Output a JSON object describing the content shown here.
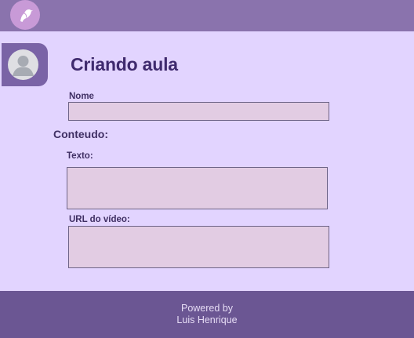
{
  "header": {
    "logo_icon": "bird-icon"
  },
  "profile": {
    "avatar_icon": "user-avatar-icon"
  },
  "form": {
    "title": "Criando aula",
    "name_label": "Nome",
    "name_value": "",
    "content_section_label": "Conteudo:",
    "text_label": "Texto:",
    "text_value": "",
    "video_url_label": "URL do vídeo:",
    "video_url_value": ""
  },
  "footer": {
    "line1": "Powered by",
    "line2": "Luis Henrique"
  },
  "colors": {
    "background": "#e2d4ff",
    "topbar": "#8a73ad",
    "footer": "#6b5693",
    "field_fill": "#e2cce3",
    "accent": "#3f2a6e"
  }
}
